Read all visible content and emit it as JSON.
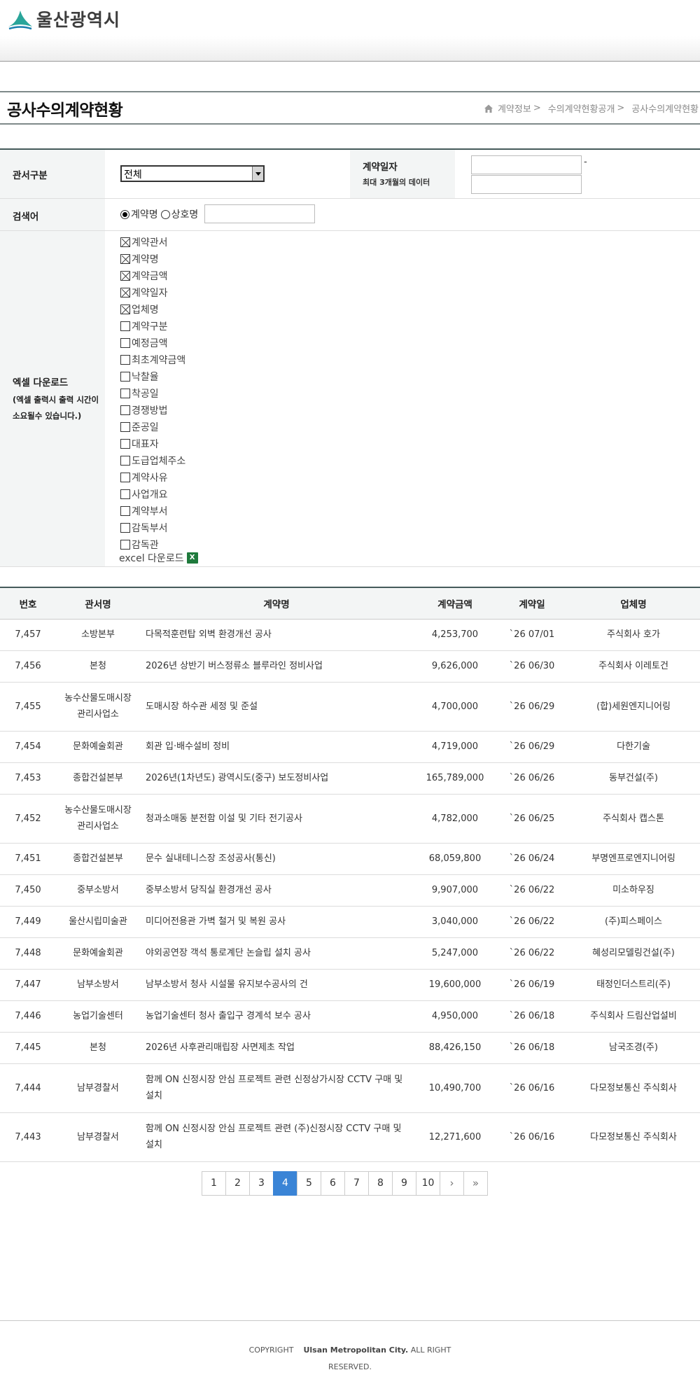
{
  "header": {
    "logo_text": "울산광역시",
    "brand_color": "#2aa59a"
  },
  "title": {
    "page_title": "공사수의계약현황",
    "breadcrumb": [
      "계약정보",
      "수의계약현황공개",
      "공사수의계약현황"
    ],
    "breadcrumb_sep": ">"
  },
  "form": {
    "office_label": "관서구분",
    "office_selected": "전체",
    "date_label": "계약일자",
    "date_note": "최대 3개월의 데이터",
    "date_from": "",
    "date_to": "",
    "date_dash": "-",
    "keyword_label": "검색어",
    "radio_contract_name": "계약명",
    "radio_company_name": "상호명",
    "keyword_value": "",
    "excel_label": "엑셀 다운로드",
    "excel_note": "(엑셀 출력시 출력 시간이 소요될수 있습니다.)",
    "excel_download_label": "excel 다운로드",
    "excel_icon_text": "X",
    "checkboxes": [
      {
        "label": "계약관서",
        "checked": true
      },
      {
        "label": "계약명",
        "checked": true
      },
      {
        "label": "계약금액",
        "checked": true
      },
      {
        "label": "계약일자",
        "checked": true
      },
      {
        "label": "업체명",
        "checked": true
      },
      {
        "label": "계약구분",
        "checked": false
      },
      {
        "label": "예정금액",
        "checked": false
      },
      {
        "label": "최초계약금액",
        "checked": false
      },
      {
        "label": "낙찰율",
        "checked": false
      },
      {
        "label": "착공일",
        "checked": false
      },
      {
        "label": "경쟁방법",
        "checked": false
      },
      {
        "label": "준공일",
        "checked": false
      },
      {
        "label": "대표자",
        "checked": false
      },
      {
        "label": "도급업체주소",
        "checked": false
      },
      {
        "label": "계약사유",
        "checked": false
      },
      {
        "label": "사업개요",
        "checked": false
      },
      {
        "label": "계약부서",
        "checked": false
      },
      {
        "label": "감독부서",
        "checked": false
      },
      {
        "label": "감독관",
        "checked": false
      }
    ]
  },
  "table": {
    "headers": [
      "번호",
      "관서명",
      "계약명",
      "계약금액",
      "계약일",
      "업체명"
    ],
    "rows": [
      {
        "no": "7,457",
        "office": "소방본부",
        "name": "다목적훈련탑 외벽 환경개선 공사",
        "amount": "4,253,700",
        "date": "`26 07/01",
        "company": "주식회사 호가"
      },
      {
        "no": "7,456",
        "office": "본청",
        "name": "2026년 상반기 버스정류소 블루라인 정비사업",
        "amount": "9,626,000",
        "date": "`26 06/30",
        "company": "주식회사 이레토건"
      },
      {
        "no": "7,455",
        "office": "농수산물도매시장\n관리사업소",
        "name": "도매시장 하수관 세정 및 준설",
        "amount": "4,700,000",
        "date": "`26 06/29",
        "company": "(합)세원엔지니어링"
      },
      {
        "no": "7,454",
        "office": "문화예술회관",
        "name": "회관 입·배수설비 정비",
        "amount": "4,719,000",
        "date": "`26 06/29",
        "company": "다한기술"
      },
      {
        "no": "7,453",
        "office": "종합건설본부",
        "name": "2026년(1차년도) 광역시도(중구) 보도정비사업",
        "amount": "165,789,000",
        "date": "`26 06/26",
        "company": "동부건설(주)"
      },
      {
        "no": "7,452",
        "office": "농수산물도매시장\n관리사업소",
        "name": "청과소매동 분전함 이설 및 기타 전기공사",
        "amount": "4,782,000",
        "date": "`26 06/25",
        "company": "주식회사 캡스톤"
      },
      {
        "no": "7,451",
        "office": "종합건설본부",
        "name": "문수 실내테니스장 조성공사(통신)",
        "amount": "68,059,800",
        "date": "`26 06/24",
        "company": "부명엔프로엔지니어링"
      },
      {
        "no": "7,450",
        "office": "중부소방서",
        "name": "중부소방서 당직실 환경개선 공사",
        "amount": "9,907,000",
        "date": "`26 06/22",
        "company": "미소하우징"
      },
      {
        "no": "7,449",
        "office": "울산시립미술관",
        "name": "미디어전용관 가벽 철거 및 복원 공사",
        "amount": "3,040,000",
        "date": "`26 06/22",
        "company": "(주)피스페이스"
      },
      {
        "no": "7,448",
        "office": "문화예술회관",
        "name": "야외공연장 객석 통로계단 논슬립 설치 공사",
        "amount": "5,247,000",
        "date": "`26 06/22",
        "company": "혜성리모델링건설(주)"
      },
      {
        "no": "7,447",
        "office": "남부소방서",
        "name": "남부소방서 청사 시설물 유지보수공사의 건",
        "amount": "19,600,000",
        "date": "`26 06/19",
        "company": "태정인더스트리(주)"
      },
      {
        "no": "7,446",
        "office": "농업기술센터",
        "name": "농업기술센터 청사 출입구 경계석 보수 공사",
        "amount": "4,950,000",
        "date": "`26 06/18",
        "company": "주식회사 드림산업설비"
      },
      {
        "no": "7,445",
        "office": "본청",
        "name": "2026년 사후관리매립장 사면제초 작업",
        "amount": "88,426,150",
        "date": "`26 06/18",
        "company": "남국조경(주)"
      },
      {
        "no": "7,444",
        "office": "남부경찰서",
        "name": "함께 ON 신정시장 안심 프로젝트 관련 신정상가시장 CCTV 구매 및 설치",
        "amount": "10,490,700",
        "date": "`26 06/16",
        "company": "다모정보통신 주식회사"
      },
      {
        "no": "7,443",
        "office": "남부경찰서",
        "name": "함께 ON 신정시장 안심 프로젝트 관련 (주)신정시장 CCTV 구매 및 설치",
        "amount": "12,271,600",
        "date": "`26 06/16",
        "company": "다모정보통신 주식회사"
      }
    ]
  },
  "pagination": {
    "pages": [
      "1",
      "2",
      "3",
      "4",
      "5",
      "6",
      "7",
      "8",
      "9",
      "10"
    ],
    "current": "4",
    "next": "›",
    "last": "»"
  },
  "footer": {
    "copyright_prefix": "COPYRIGHT",
    "org": "Ulsan Metropolitan City.",
    "rights": "ALL RIGHT RESERVED."
  }
}
